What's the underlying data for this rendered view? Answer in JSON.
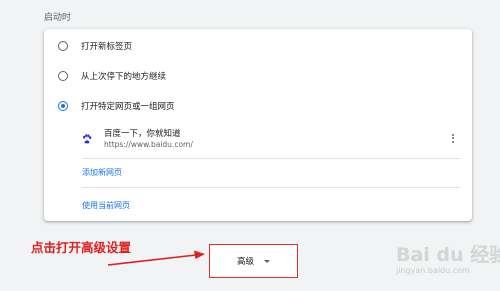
{
  "startup": {
    "title": "启动时",
    "options": [
      {
        "label": "打开新标签页",
        "checked": false
      },
      {
        "label": "从上次停下的地方继续",
        "checked": false
      },
      {
        "label": "打开特定网页或一组网页",
        "checked": true
      }
    ],
    "page": {
      "title": "百度一下，你就知道",
      "url": "https://www.baidu.com/",
      "icon": "baidu-paw-icon",
      "icon_color": "#2932e1",
      "menu_icon": "more-vert-icon"
    },
    "add_page_label": "添加新网页",
    "use_current_label": "使用当前网页"
  },
  "annotation": {
    "text": "点击打开高级设置",
    "color": "#e02020"
  },
  "advanced": {
    "label": "高级",
    "caret_icon": "caret-down-icon",
    "highlight_color": "#e0302a"
  },
  "watermark": {
    "text": "Bai du 经验",
    "url": "jingyan.baidu.com"
  },
  "colors": {
    "accent": "#1a73e8",
    "background": "#f1f3f4"
  }
}
